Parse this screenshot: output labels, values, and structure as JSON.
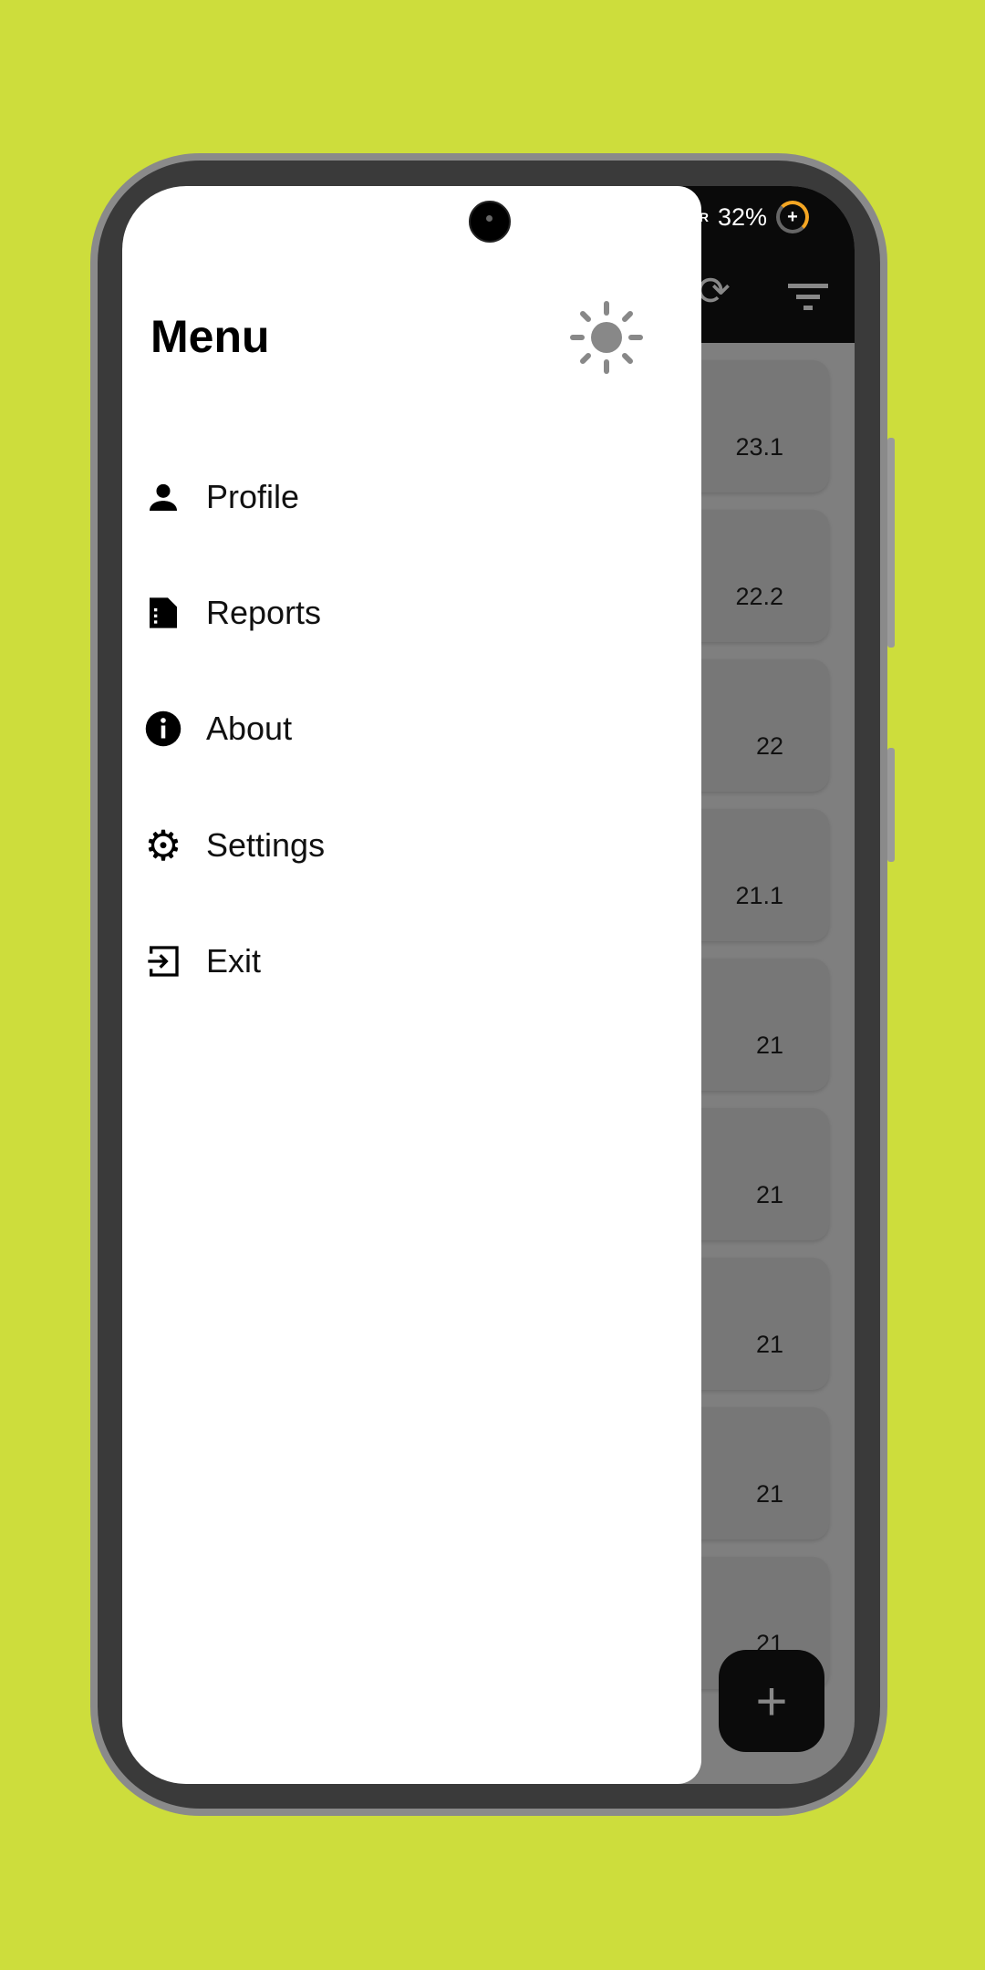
{
  "status_bar": {
    "network": "G R",
    "battery": "32%"
  },
  "app_bar": {
    "refresh_icon": "refresh-icon",
    "filter_icon": "filter-icon"
  },
  "list": {
    "values": [
      "23.1",
      "22.2",
      "22",
      "21.1",
      "21",
      "21",
      "21",
      "21",
      "21"
    ]
  },
  "fab": {
    "label": "+"
  },
  "drawer": {
    "title": "Menu",
    "theme_icon": "sun-icon",
    "items": [
      {
        "label": "Profile",
        "icon": "person-icon"
      },
      {
        "label": "Reports",
        "icon": "report-icon"
      },
      {
        "label": "About",
        "icon": "info-icon"
      },
      {
        "label": "Settings",
        "icon": "gear-icon"
      },
      {
        "label": "Exit",
        "icon": "exit-icon"
      }
    ]
  },
  "colors": {
    "background": "#cddd3c",
    "app_bar": "#0a0a0a",
    "drawer": "#ffffff",
    "battery_accent": "#f5a623"
  }
}
